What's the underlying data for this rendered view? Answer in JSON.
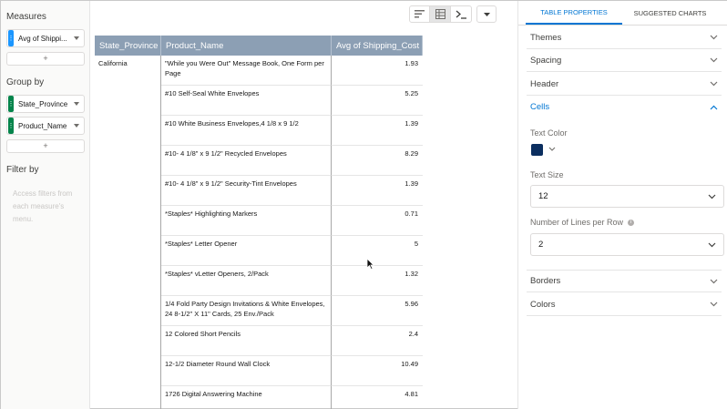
{
  "left_panel": {
    "measures_title": "Measures",
    "measures": [
      {
        "label": "Avg of Shippi..."
      }
    ],
    "add_label": "+",
    "group_by_title": "Group by",
    "groups": [
      {
        "label": "State_Province"
      },
      {
        "label": "Product_Name"
      }
    ],
    "filter_by_title": "Filter by",
    "filter_hint": "Access filters from each measure's menu."
  },
  "toolbar": {
    "icons": [
      "bar-chart-icon",
      "table-view-icon",
      "query-mode-icon"
    ],
    "active": "table-view-icon",
    "dropdown_icon": "chevron-down-icon"
  },
  "table": {
    "columns": [
      "State_Province",
      "Product_Name",
      "Avg of Shipping_Cost"
    ],
    "state": "California",
    "rows": [
      {
        "product": "\"While you Were Out\" Message Book, One Form per Page",
        "cost": "1.93"
      },
      {
        "product": "#10 Self-Seal White Envelopes",
        "cost": "5.25"
      },
      {
        "product": "#10 White Business Envelopes,4 1/8 x 9 1/2",
        "cost": "1.39"
      },
      {
        "product": "#10- 4 1/8\" x 9 1/2\" Recycled Envelopes",
        "cost": "8.29"
      },
      {
        "product": "#10- 4 1/8\" x 9 1/2\" Security-Tint Envelopes",
        "cost": "1.39"
      },
      {
        "product": "*Staples* Highlighting Markers",
        "cost": "0.71"
      },
      {
        "product": "*Staples* Letter Opener",
        "cost": "5"
      },
      {
        "product": "*Staples* vLetter Openers, 2/Pack",
        "cost": "1.32"
      },
      {
        "product": "1/4 Fold Party Design Invitations & White Envelopes, 24 8-1/2\" X 11\" Cards, 25 Env./Pack",
        "cost": "5.96"
      },
      {
        "product": "12 Colored Short Pencils",
        "cost": "2.4"
      },
      {
        "product": "12-1/2 Diameter Round Wall Clock",
        "cost": "10.49"
      },
      {
        "product": "1726 Digital Answering Machine",
        "cost": "4.81"
      }
    ]
  },
  "right_panel": {
    "tabs": [
      "TABLE PROPERTIES",
      "SUGGESTED CHARTS"
    ],
    "active_tab": "TABLE PROPERTIES",
    "sections": {
      "themes": "Themes",
      "spacing": "Spacing",
      "header": "Header",
      "cells": "Cells",
      "borders": "Borders",
      "colors": "Colors"
    },
    "cells": {
      "text_color_label": "Text Color",
      "text_color": "#0b2e5f",
      "text_size_label": "Text Size",
      "text_size_value": "12",
      "lines_label": "Number of Lines per Row",
      "lines_value": "2"
    }
  }
}
